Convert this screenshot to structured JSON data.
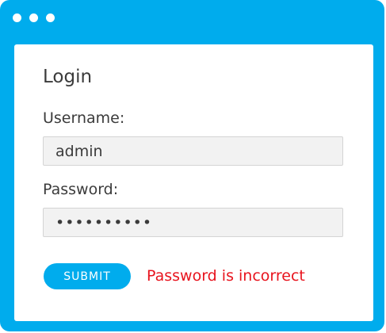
{
  "window": {
    "accent_color": "#00aced",
    "controls": [
      "window-dot",
      "window-dot",
      "window-dot"
    ]
  },
  "login": {
    "title": "Login",
    "username_label": "Username:",
    "username_value": "admin",
    "password_label": "Password:",
    "password_value": "••••••••••",
    "submit_label": "SUBMIT",
    "error_message": "Password is incorrect",
    "error_color": "#e8141e"
  }
}
